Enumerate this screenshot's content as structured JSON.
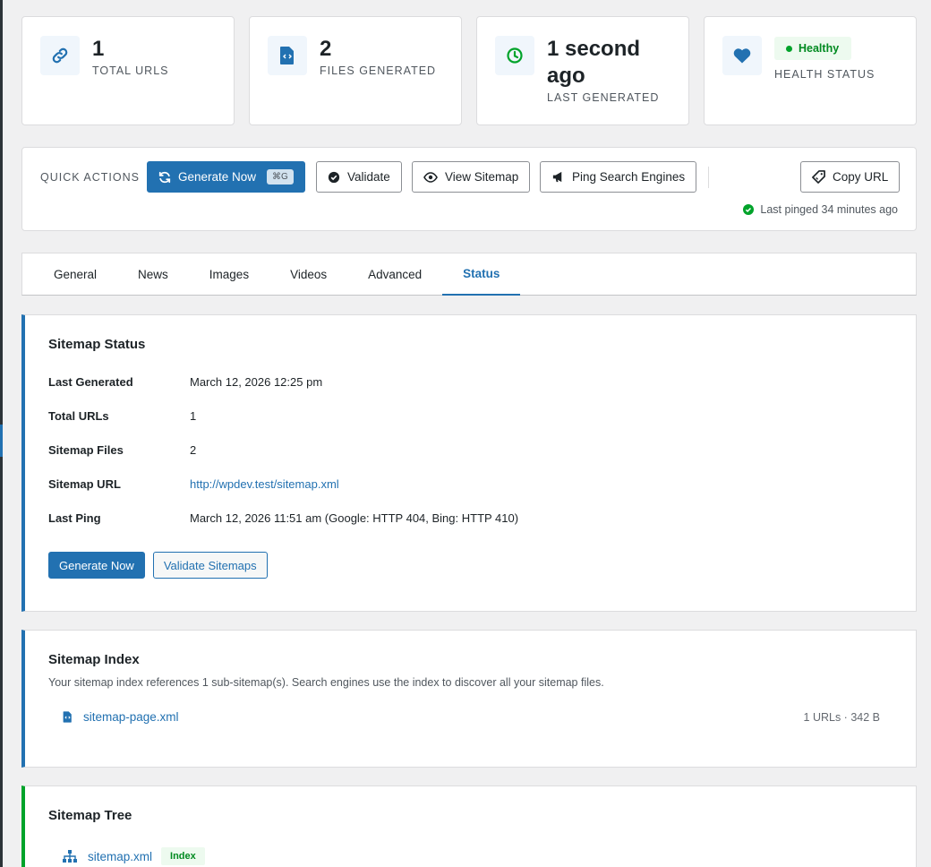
{
  "stats": [
    {
      "value": "1",
      "label": "TOTAL URLS",
      "icon": "link-icon"
    },
    {
      "value": "2",
      "label": "FILES GENERATED",
      "icon": "code-file-icon"
    },
    {
      "value_line1": "1 second",
      "value_line2": "ago",
      "label": "LAST GENERATED",
      "icon": "clock-icon"
    },
    {
      "pill": "Healthy",
      "label": "HEALTH STATUS",
      "icon": "heart-icon"
    }
  ],
  "quick_actions": {
    "label": "QUICK ACTIONS",
    "generate": "Generate Now",
    "shortcut": "⌘G",
    "validate": "Validate",
    "view": "View Sitemap",
    "ping": "Ping Search Engines",
    "copy": "Copy URL",
    "last_pinged": "Last pinged 34 minutes ago"
  },
  "tabs": [
    "General",
    "News",
    "Images",
    "Videos",
    "Advanced",
    "Status"
  ],
  "status_panel": {
    "title": "Sitemap Status",
    "rows": [
      {
        "key": "Last Generated",
        "value": "March 12, 2026 12:25 pm"
      },
      {
        "key": "Total URLs",
        "value": "1"
      },
      {
        "key": "Sitemap Files",
        "value": "2"
      },
      {
        "key": "Sitemap URL",
        "value": "http://wpdev.test/sitemap.xml"
      },
      {
        "key": "Last Ping",
        "value": "March 12, 2026 11:51 am (Google: HTTP 404, Bing: HTTP 410)"
      }
    ],
    "generate_button": "Generate Now",
    "validate_button": "Validate Sitemaps"
  },
  "index_panel": {
    "title": "Sitemap Index",
    "description": "Your sitemap index references 1 sub-sitemap(s). Search engines use the index to discover all your sitemap files.",
    "files": [
      {
        "name": "sitemap-page.xml",
        "meta": "1 URLs · 342 B"
      }
    ]
  },
  "tree_panel": {
    "title": "Sitemap Tree",
    "root": "sitemap.xml",
    "badge": "Index"
  },
  "colors": {
    "accent": "#2271b1",
    "success": "#00a32a",
    "background": "#f0f0f1"
  }
}
